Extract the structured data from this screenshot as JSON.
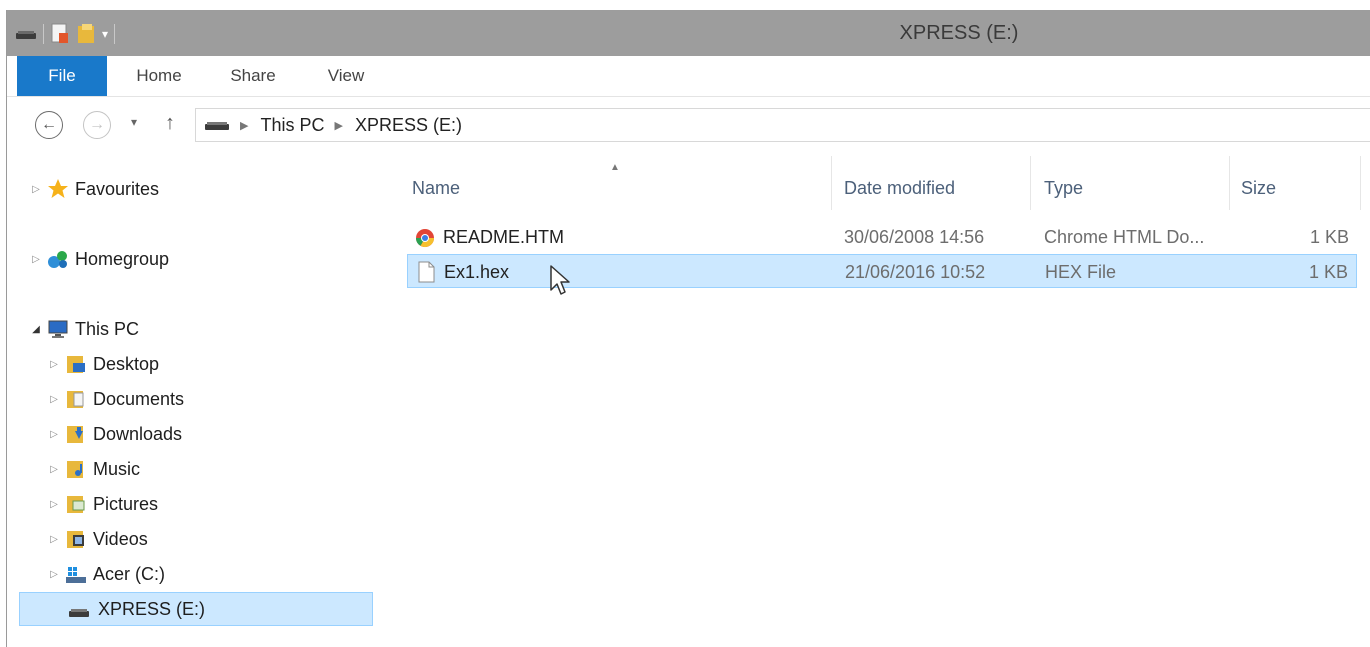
{
  "window": {
    "title": "XPRESS (E:)"
  },
  "ribbon": {
    "tabs": [
      "File",
      "Home",
      "Share",
      "View"
    ]
  },
  "address": {
    "crumbs": [
      "This PC",
      "XPRESS (E:)"
    ]
  },
  "sidebar": {
    "groups": [
      {
        "label": "Favourites",
        "icon": "star-icon"
      },
      {
        "label": "Homegroup",
        "icon": "homegroup-icon"
      },
      {
        "label": "This PC",
        "icon": "computer-icon"
      }
    ],
    "pc_items": [
      {
        "label": "Desktop",
        "icon": "desktop-folder-icon"
      },
      {
        "label": "Documents",
        "icon": "documents-folder-icon"
      },
      {
        "label": "Downloads",
        "icon": "downloads-folder-icon"
      },
      {
        "label": "Music",
        "icon": "music-folder-icon"
      },
      {
        "label": "Pictures",
        "icon": "pictures-folder-icon"
      },
      {
        "label": "Videos",
        "icon": "videos-folder-icon"
      },
      {
        "label": "Acer (C:)",
        "icon": "system-drive-icon"
      },
      {
        "label": "XPRESS (E:)",
        "icon": "removable-drive-icon"
      }
    ]
  },
  "columns": {
    "name": "Name",
    "date": "Date modified",
    "type": "Type",
    "size": "Size"
  },
  "files": [
    {
      "name": "README.HTM",
      "date": "30/06/2008 14:56",
      "type": "Chrome HTML Do...",
      "size": "1 KB",
      "icon": "chrome-icon"
    },
    {
      "name": "Ex1.hex",
      "date": "21/06/2016 10:52",
      "type": "HEX File",
      "size": "1 KB",
      "icon": "blank-file-icon"
    }
  ],
  "colors": {
    "accent": "#1979ca",
    "selection": "#cce8ff",
    "selection_border": "#99d1ff",
    "titlebar": "#9d9d9d"
  }
}
